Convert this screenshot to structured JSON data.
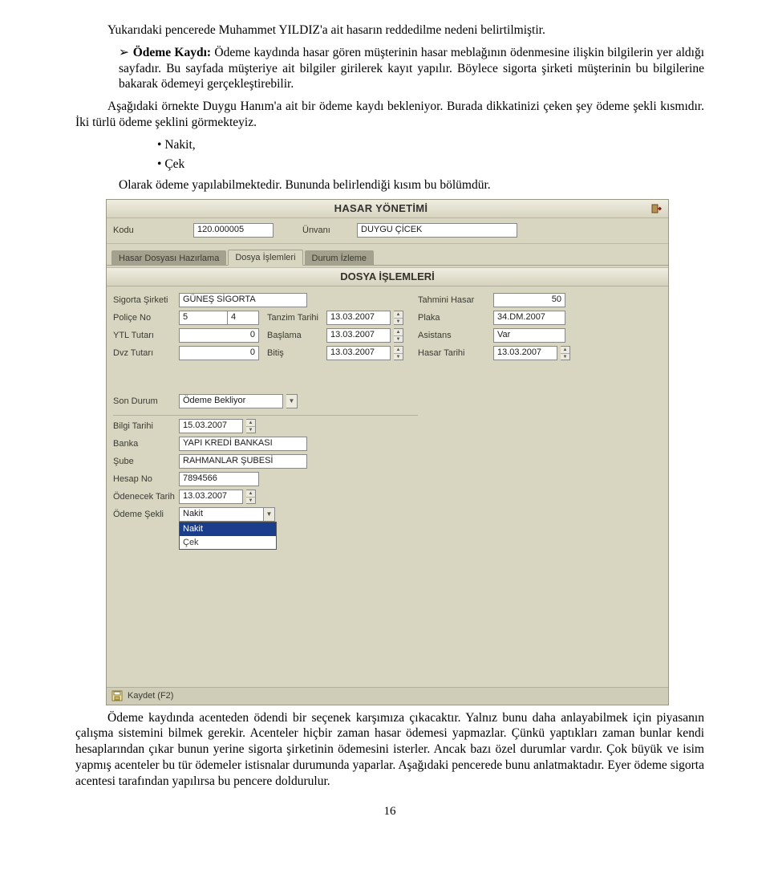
{
  "doc": {
    "p1": "Yukarıdaki pencerede Muhammet YILDIZ'a ait hasarın reddedilme nedeni belirtilmiştir.",
    "p2_label": "Ödeme Kaydı:",
    "p2": " Ödeme kaydında hasar gören müşterinin hasar meblağının ödenmesine ilişkin bilgilerin yer aldığı sayfadır. Bu sayfada müşteriye ait bilgiler girilerek kayıt yapılır. Böylece sigorta şirketi müşterinin bu bilgilerine bakarak ödemeyi gerçekleştirebilir.",
    "p3": "Aşağıdaki örnekte Duygu Hanım'a ait bir ödeme kaydı bekleniyor. Burada dikkatinizi çeken şey ödeme şekli kısmıdır. İki türlü ödeme şeklini görmekteyiz.",
    "b1": "Nakit,",
    "b2": "Çek",
    "p4": "Olarak ödeme yapılabilmektedir. Bununda belirlendiği kısım bu bölümdür.",
    "p5": "Ödeme kaydında acenteden ödendi bir seçenek karşımıza çıkacaktır. Yalnız bunu daha anlayabilmek için piyasanın çalışma sistemini bilmek gerekir. Acenteler hiçbir zaman hasar ödemesi yapmazlar. Çünkü yaptıkları zaman bunlar kendi hesaplarından çıkar bunun yerine sigorta şirketinin ödemesini isterler. Ancak bazı özel durumlar vardır. Çok büyük ve isim yapmış acenteler bu tür ödemeler istisnalar durumunda yaparlar. Aşağıdaki pencerede bunu anlatmaktadır. Eyer ödeme sigorta acentesi tarafından yapılırsa bu pencere doldurulur.",
    "pagenum": "16"
  },
  "app": {
    "title": "HASAR YÖNETİMİ",
    "header": {
      "kodu_label": "Kodu",
      "kodu": "120.000005",
      "unvani_label": "Ünvanı",
      "unvani": "DUYGU ÇİCEK"
    },
    "tabs": {
      "t1": "Hasar Dosyası Hazırlama",
      "t2": "Dosya İşlemleri",
      "t3": "Durum İzleme"
    },
    "section_title": "DOSYA İŞLEMLERİ",
    "left": {
      "sigorta_sirketi_label": "Sigorta Şirketi",
      "sigorta_sirketi": "GÜNEŞ SİGORTA",
      "police_label": "Poliçe No",
      "police_a": "5",
      "police_b": "4",
      "tanzim_label": "Tanzim Tarihi",
      "tanzim": "13.03.2007",
      "ytl_label": "YTL Tutarı",
      "ytl": "0",
      "baslama_label": "Başlama",
      "baslama": "13.03.2007",
      "dvz_label": "Dvz Tutarı",
      "dvz": "0",
      "bitis_label": "Bitiş",
      "bitis": "13.03.2007",
      "son_durum_label": "Son Durum",
      "son_durum": "Ödeme Bekliyor",
      "bilgi_label": "Bilgi Tarihi",
      "bilgi": "15.03.2007",
      "banka_label": "Banka",
      "banka": "YAPI KREDİ BANKASI",
      "sube_label": "Şube",
      "sube": "RAHMANLAR ŞUBESİ",
      "hesap_label": "Hesap No",
      "hesap": "7894566",
      "odenecek_label": "Ödenecek Tarih",
      "odenecek": "13.03.2007",
      "odeme_sekli_label": "Ödeme Şekli",
      "odeme_sekli": "Nakit",
      "opt1": "Nakit",
      "opt2": "Çek"
    },
    "right": {
      "tahmini_label": "Tahmini Hasar",
      "tahmini": "50",
      "plaka_label": "Plaka",
      "plaka": "34.DM.2007",
      "asistans_label": "Asistans",
      "asistans": "Var",
      "hasar_tarihi_label": "Hasar Tarihi",
      "hasar_tarihi": "13.03.2007"
    },
    "save_label": "Kaydet (F2)"
  }
}
